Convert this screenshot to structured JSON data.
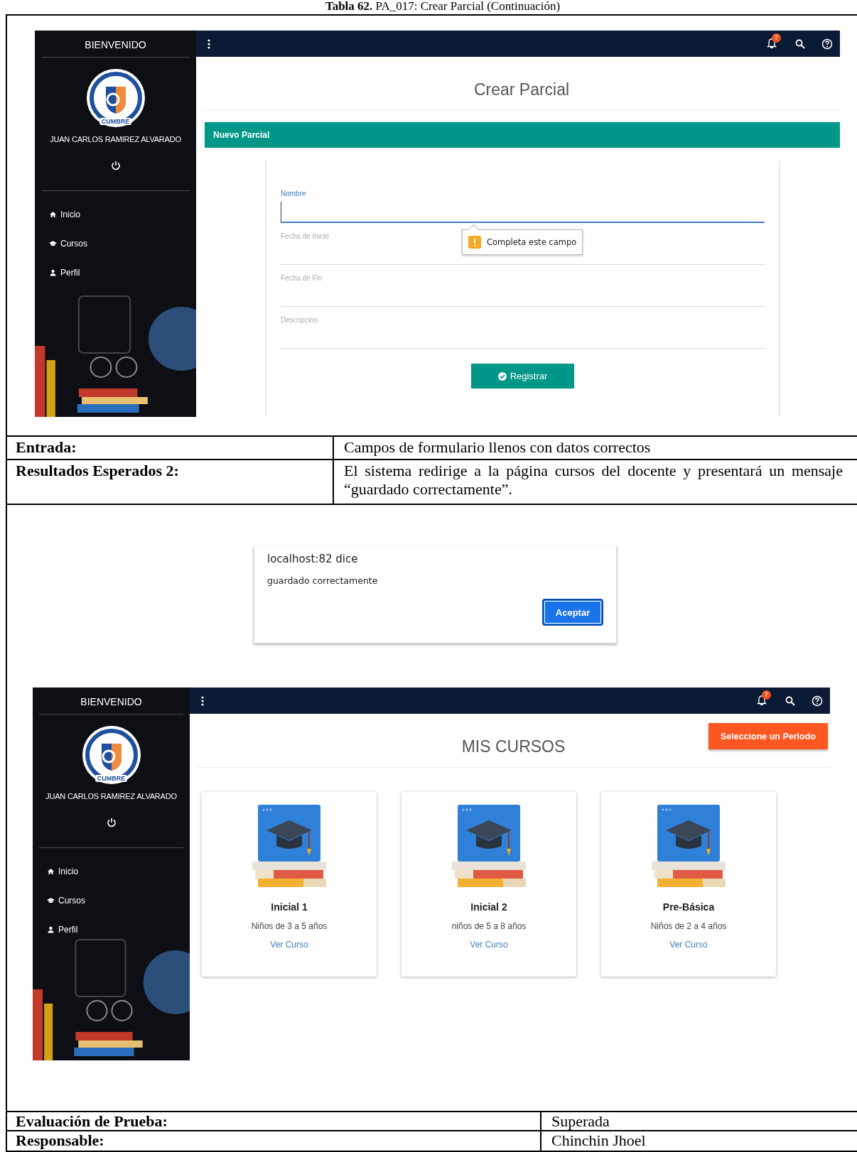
{
  "caption": "**Tabla 62.** PA_017: Crear Parcial (Continuación)",
  "screen_1": {
    "sidebar": {
      "title": "BIENVENIDO",
      "logo_text": "CUMBRE",
      "user": "JUAN CARLOS RAMIREZ ALVARADO",
      "nav": [
        {
          "kind": "home",
          "label": "Inicio"
        },
        {
          "kind": "cap",
          "label": "Cursos"
        },
        {
          "kind": "person",
          "label": "Perfil"
        }
      ]
    },
    "notification_count": "7",
    "page_title": "Crear Parcial",
    "panel_title": "Nuevo Parcial",
    "fields": [
      {
        "label": "Nombre",
        "focused": true
      },
      {
        "label": "Fecha de Inicio",
        "focused": false
      },
      {
        "label": "Fecha de Fin",
        "focused": false
      },
      {
        "label": "Descripcion",
        "focused": false
      }
    ],
    "tooltip": "Completa este campo",
    "submit": "Registrar"
  },
  "rows": [
    {
      "label": "Entrada:",
      "value": "Campos de formulario llenos con datos correctos"
    },
    {
      "label": "Resultados Esperados 2:",
      "value": "El sistema redirige a la página cursos del docente y presentará un mensaje “guardado correctamente”."
    }
  ],
  "dialog": {
    "title": "localhost:82 dice",
    "message": "guardado correctamente",
    "button": "Aceptar"
  },
  "screen_2": {
    "sidebar": {
      "title": "BIENVENIDO",
      "logo_text": "CUMBRE",
      "user": "JUAN CARLOS RAMIREZ ALVARADO",
      "nav": [
        {
          "kind": "home",
          "label": "Inicio"
        },
        {
          "kind": "cap",
          "label": "Cursos"
        },
        {
          "kind": "person",
          "label": "Perfil"
        }
      ]
    },
    "notification_count": "7",
    "page_title": "MIS CURSOS",
    "period_button": "Seleccione un Periodo",
    "courses": [
      {
        "name": "Inicial 1",
        "description": "Niños de 3 a 5 años",
        "link": "Ver Curso"
      },
      {
        "name": "Inicial 2",
        "description": "niños de 5 a 8 años",
        "link": "Ver Curso"
      },
      {
        "name": "Pre-Básica",
        "description": "Niños de 2 a 4 años",
        "link": "Ver Curso"
      }
    ]
  },
  "footer_rows": [
    {
      "label": "Evaluación de Prueba:",
      "value": "Superada"
    },
    {
      "label": "Responsable:",
      "value": "Chinchin Jhoel"
    }
  ]
}
